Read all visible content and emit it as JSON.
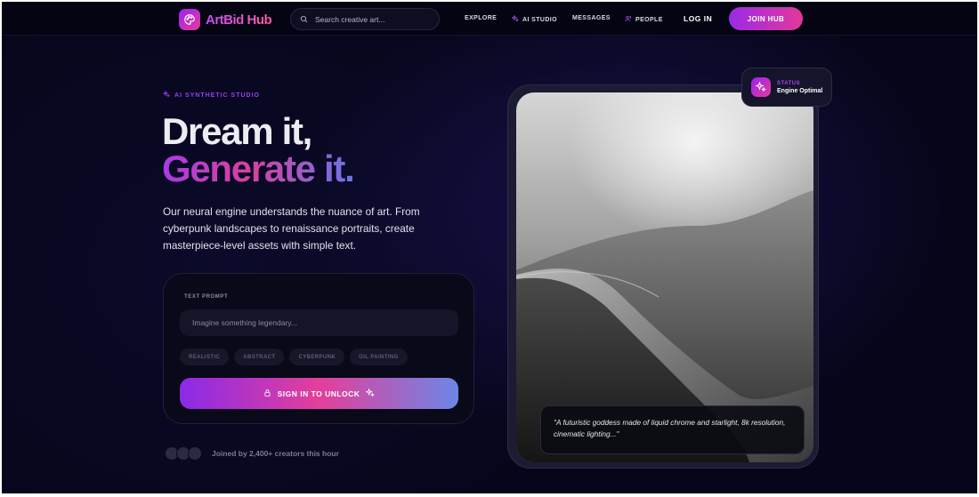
{
  "brand": {
    "name": "ArtBid Hub",
    "logo_icon": "palette-icon"
  },
  "nav": {
    "search_placeholder": "Search creative art...",
    "links": [
      {
        "label": "EXPLORE"
      },
      {
        "label": "AI STUDIO",
        "icon": "sparkles-icon"
      },
      {
        "label": "MESSAGES"
      },
      {
        "label": "PEOPLE",
        "icon": "users-icon"
      }
    ],
    "login": "LOG IN",
    "join": "JOIN HUB"
  },
  "hero": {
    "eyebrow": "AI SYNTHETIC STUDIO",
    "headline_1": "Dream it,",
    "headline_2": "Generate it.",
    "description": "Our neural engine understands the nuance of art. From cyberpunk landscapes to renaissance portraits, create masterpiece-level assets with simple text."
  },
  "prompt_card": {
    "label": "TEXT PROMPT",
    "placeholder": "Imagine something legendary...",
    "styles": [
      "REALISTIC",
      "ABSTRACT",
      "CYBERPUNK",
      "OIL PAINTING"
    ],
    "button": "SIGN IN TO UNLOCK"
  },
  "social": {
    "joined": "Joined by 2,400+ creators this hour"
  },
  "preview": {
    "caption": "\"A futuristic goddess made of liquid chrome and starlight, 8k resolution, cinematic lighting...\"",
    "status_label": "STATUS",
    "status_value": "Engine Optimal"
  },
  "colors": {
    "accent_purple": "#9b3ef0",
    "accent_pink": "#e23c9a",
    "accent_blue": "#6b74e8",
    "background": "#06061a"
  }
}
